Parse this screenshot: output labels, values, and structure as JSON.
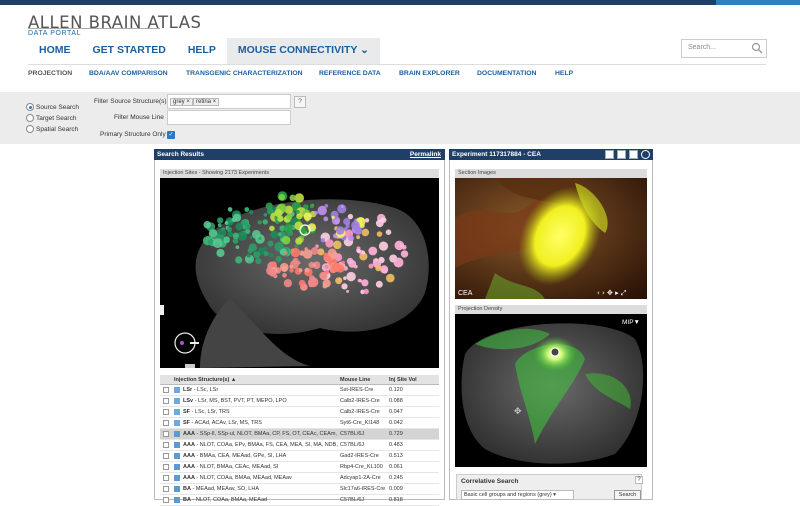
{
  "brand": {
    "title": "ALLEN BRAIN ATLAS",
    "subtitle": "DATA PORTAL"
  },
  "nav": [
    {
      "label": "HOME"
    },
    {
      "label": "GET STARTED"
    },
    {
      "label": "HELP"
    },
    {
      "label": "MOUSE CONNECTIVITY ⌄"
    }
  ],
  "search": {
    "placeholder": "Search..."
  },
  "subnav": [
    {
      "label": "PROJECTION"
    },
    {
      "label": "BDA/AAV COMPARISON"
    },
    {
      "label": "TRANSGENIC CHARACTERIZATION"
    },
    {
      "label": "REFERENCE DATA"
    },
    {
      "label": "BRAIN EXPLORER"
    },
    {
      "label": "DOCUMENTATION"
    },
    {
      "label": "HELP"
    }
  ],
  "filters": {
    "radios": [
      {
        "label": "Source Search",
        "checked": true
      },
      {
        "label": "Target Search",
        "checked": false
      },
      {
        "label": "Spatial Search",
        "checked": false
      }
    ],
    "source_label": "Filter Source Structure(s)",
    "source_tags": [
      "grey ×",
      "retina ×"
    ],
    "help": "?",
    "mouse_line_label": "Filter Mouse Line",
    "primary_label": "Primary Structure Only",
    "primary_checked": true
  },
  "results": {
    "title": "Search Results",
    "permalink": "Permalink",
    "injection_header": "Injection Sites - Showing 2173 Experiments",
    "columns": [
      "Injection Structure(s) ▲",
      "Mouse Line",
      "Inj Site Vol"
    ],
    "rows": [
      {
        "structure": "LSr",
        "rest": " - LSc, LSr",
        "line": "Sst-IRES-Cre",
        "vol": "0.120",
        "color": "#6fa8dc",
        "selected": false
      },
      {
        "structure": "LSv",
        "rest": " - LSr, MS, BST, PVT, PT, MEPO, LPO",
        "line": "Calb2-IRES-Cre",
        "vol": "0.088",
        "color": "#6fa8dc",
        "selected": false
      },
      {
        "structure": "SF",
        "rest": " - LSc, LSr, TRS",
        "line": "Calb2-IRES-Cre",
        "vol": "0.047",
        "color": "#6fa8dc",
        "selected": false
      },
      {
        "structure": "SF",
        "rest": " - ACAd, ACAv, LSr, MS, TRS",
        "line": "Syt6-Cre_KI148",
        "vol": "0.042",
        "color": "#6fa8dc",
        "selected": false
      },
      {
        "structure": "AAA",
        "rest": " - SSp-ll, SSp-ul, NLOT, BMAa, CP, FS, OT, CEAc, CEAm,",
        "line": "C57BL/6J",
        "vol": "0.729",
        "color": "#5b9bd5",
        "selected": true
      },
      {
        "structure": "AAA",
        "rest": " - NLOT, COAa, EPv, BMAa, FS, CEA, MEA, SI, MA, NDB, L",
        "line": "C57BL/6J",
        "vol": "0.483",
        "color": "#5b9bd5",
        "selected": false
      },
      {
        "structure": "AAA",
        "rest": " - BMAa, CEA, MEAad, GPe, SI, LHA",
        "line": "Gad2-IRES-Cre",
        "vol": "0.513",
        "color": "#5b9bd5",
        "selected": false
      },
      {
        "structure": "AAA",
        "rest": " - NLOT, BMAa, CEAc, MEAad, SI",
        "line": "Rbp4-Cre_KL100",
        "vol": "0.061",
        "color": "#5b9bd5",
        "selected": false
      },
      {
        "structure": "AAA",
        "rest": " - NLOT, COAa, BMAa, MEAad, MEAav",
        "line": "Adcyap1-2A-Cre",
        "vol": "0.245",
        "color": "#5b9bd5",
        "selected": false
      },
      {
        "structure": "BA",
        "rest": " - MEAad, MEAav, SO, LHA",
        "line": "Slc17a6-IRES-Cre",
        "vol": "0.009",
        "color": "#5b9bd5",
        "selected": false
      },
      {
        "structure": "BA",
        "rest": " - NLOT, COAa, BMAa, MEAad",
        "line": "C57BL/6J",
        "vol": "0.818",
        "color": "#5b9bd5",
        "selected": false
      }
    ]
  },
  "experiment": {
    "title": "Experiment 117317884 - CEA",
    "section_header": "Section Images",
    "section_label": "CEA",
    "density_header": "Projection Density",
    "mip_label": "MIP▼"
  },
  "correlative": {
    "title": "Correlative Search",
    "select_value": "Basic cell groups and regions (grey)",
    "button": "Search",
    "help": "?"
  },
  "colors": {
    "nav_blue": "#1b5fa0",
    "header_navy": "#1f3f66",
    "accent": "#2f7fc1"
  }
}
